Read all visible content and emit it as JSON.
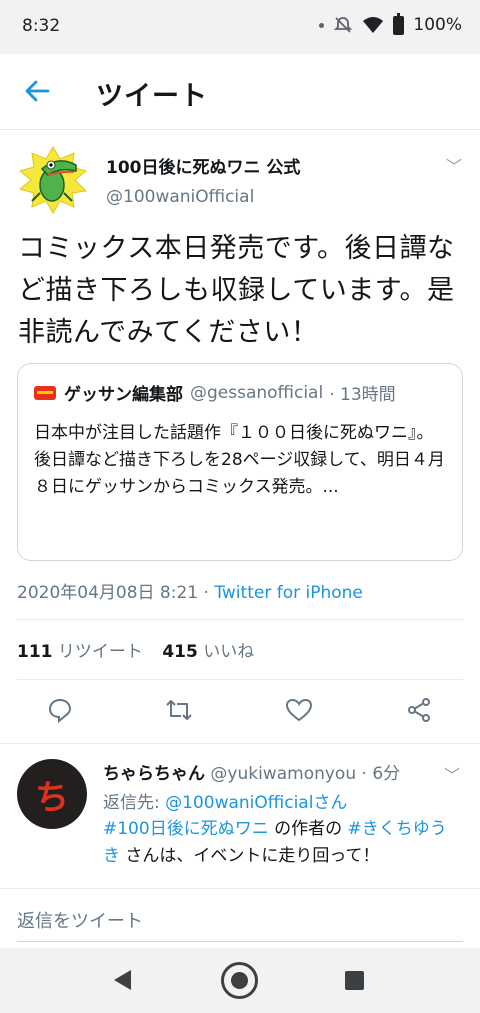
{
  "status_bar": {
    "time": "8:32",
    "battery": "100%"
  },
  "header": {
    "title": "ツイート"
  },
  "tweet": {
    "author_name": "100日後に死ぬワニ 公式",
    "author_handle": "@100waniOfficial",
    "text": "コミックス本日発売です。後日譚など描き下ろしも収録しています。是非読んでみてください！",
    "timestamp": "2020年04月08日 8:21",
    "separator": "·",
    "source": "Twitter for iPhone"
  },
  "quoted_tweet": {
    "author_name": "ゲッサン編集部",
    "author_handle": "@gessanofficial",
    "time_ago": "· 13時間",
    "text": "日本中が注目した話題作『１００日後に死ぬワニ』。後日譚など描き下ろしを28ページ収録して、明日４月８日にゲッサンからコミックス発売。..."
  },
  "stats": {
    "retweets_count": "111",
    "retweets_label": "リツイート",
    "likes_count": "415",
    "likes_label": "いいね"
  },
  "reply": {
    "avatar_char": "ち",
    "author_name": "ちゃらちゃん",
    "author_handle": "@yukiwamonyou",
    "time_ago": "· 6分",
    "replying_to_label": "返信先:",
    "replying_to_user": "@100waniOfficialさん",
    "hashtag1": "#100日後に死ぬワニ",
    "text1": " の作者の ",
    "hashtag2": "#きくちゆうき",
    "text2": " さんは、イベントに走り回って！"
  },
  "composer": {
    "placeholder": "返信をツイート"
  },
  "colors": {
    "link": "#1b95e0",
    "secondary": "#657786",
    "text": "#14171a"
  }
}
